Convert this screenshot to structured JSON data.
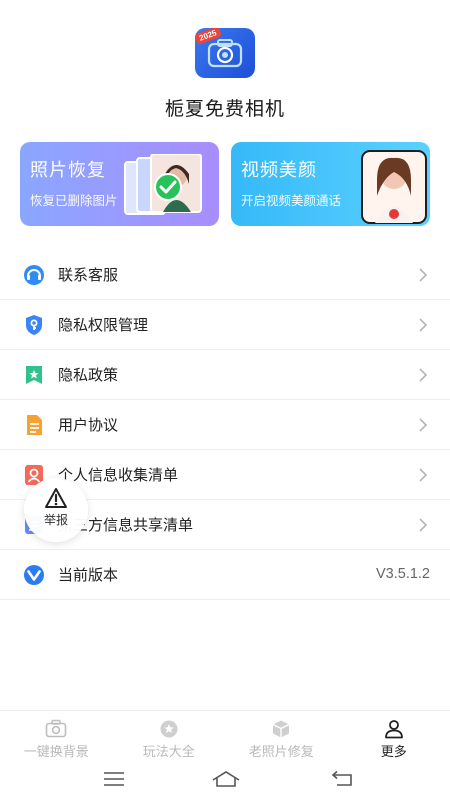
{
  "app": {
    "logo_badge": "2025",
    "name": "栀夏免费相机"
  },
  "cards": [
    {
      "title": "照片恢复",
      "subtitle": "恢复已删除图片"
    },
    {
      "title": "视频美颜",
      "subtitle": "开启视频美颜通话"
    }
  ],
  "menu": [
    {
      "label": "联系客服",
      "icon": "headset-icon",
      "color": "#2f8cf5"
    },
    {
      "label": "隐私权限管理",
      "icon": "shield-key-icon",
      "color": "#3b83f6"
    },
    {
      "label": "隐私政策",
      "icon": "bookmark-star-icon",
      "color": "#31c18c"
    },
    {
      "label": "用户协议",
      "icon": "document-icon",
      "color": "#f7a130"
    },
    {
      "label": "个人信息收集清单",
      "icon": "person-card-icon",
      "color": "#f26a5a"
    },
    {
      "label": "第三方信息共享清单",
      "icon": "list-icon",
      "color": "#6c8cf5"
    },
    {
      "label": "当前版本",
      "icon": "version-icon",
      "color": "#2b7cf0",
      "value": "V3.5.1.2"
    }
  ],
  "report": {
    "label": "举报"
  },
  "tabs": [
    {
      "label": "一键换背景",
      "icon": "camera-icon",
      "active": false
    },
    {
      "label": "玩法大全",
      "icon": "star-circle-icon",
      "active": false
    },
    {
      "label": "老照片修复",
      "icon": "cube-icon",
      "active": false
    },
    {
      "label": "更多",
      "icon": "person-icon",
      "active": true
    }
  ],
  "nav": [
    "menu-icon",
    "home-icon",
    "back-icon"
  ]
}
